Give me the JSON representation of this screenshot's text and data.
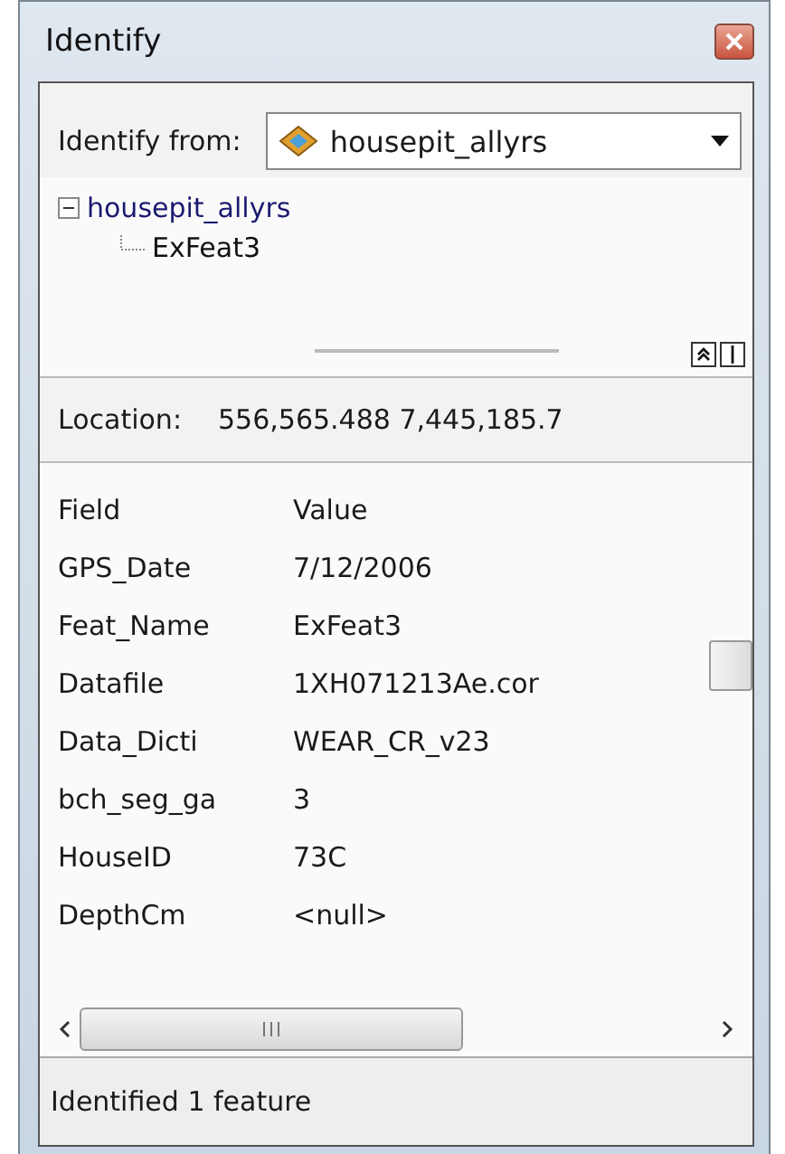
{
  "window": {
    "title": "Identify"
  },
  "identify_from": {
    "label": "Identify from:",
    "value": "housepit_allyrs"
  },
  "tree": [
    {
      "label": "housepit_allyrs",
      "expanded": true,
      "children": [
        {
          "label": "ExFeat3"
        }
      ]
    }
  ],
  "location": {
    "label": "Location:",
    "value": "556,565.488  7,445,185.7"
  },
  "table": {
    "columns": [
      "Field",
      "Value"
    ],
    "rows": [
      {
        "field": "GPS_Date",
        "value": "7/12/2006"
      },
      {
        "field": "Feat_Name",
        "value": "ExFeat3"
      },
      {
        "field": "Datafile",
        "value": "1XH071213Ae.cor"
      },
      {
        "field": "Data_Dicti",
        "value": "WEAR_CR_v23"
      },
      {
        "field": "bch_seg_ga",
        "value": "3"
      },
      {
        "field": "HouseID",
        "value": "73C"
      },
      {
        "field": "DepthCm",
        "value": "<null>"
      }
    ]
  },
  "status_bar": "Identified 1 feature"
}
